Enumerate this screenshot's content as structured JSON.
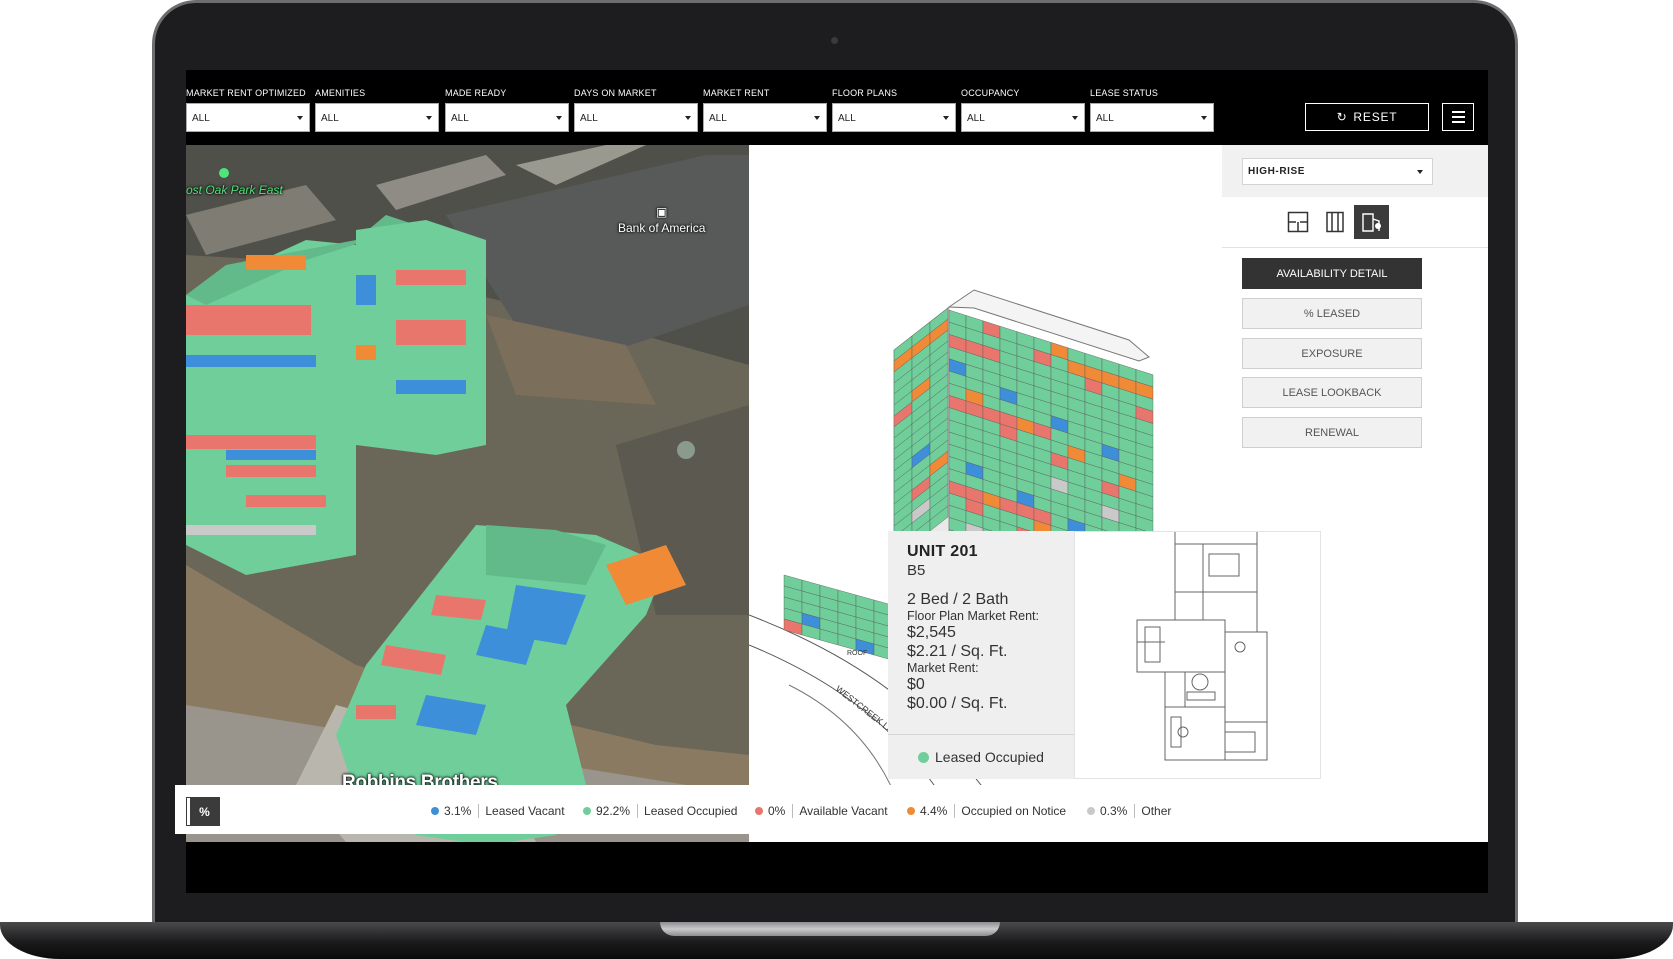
{
  "colors": {
    "leased_occupied": "#6fce9a",
    "leased_vacant": "#3d8fd9",
    "available_vacant": "#e8766c",
    "occupied_on_notice": "#f08a36",
    "other": "#c9c9c9"
  },
  "filters": [
    {
      "label": "MARKET RENT OPTIMIZED",
      "value": "ALL"
    },
    {
      "label": "AMENITIES",
      "value": "ALL"
    },
    {
      "label": "MADE READY",
      "value": "ALL"
    },
    {
      "label": "DAYS ON MARKET",
      "value": "ALL"
    },
    {
      "label": "MARKET RENT",
      "value": "ALL"
    },
    {
      "label": "FLOOR PLANS",
      "value": "ALL"
    },
    {
      "label": "OCCUPANCY",
      "value": "ALL"
    },
    {
      "label": "LEASE STATUS",
      "value": "ALL"
    }
  ],
  "toolbar": {
    "reset_label": "RESET",
    "reset_icon": "refresh-icon",
    "menu_icon": "hamburger-icon"
  },
  "map": {
    "labels": {
      "park": "ost Oak Park East",
      "bank": "Bank of America",
      "store": "Robbins Brothers"
    }
  },
  "stack": {
    "roof_label": "ROOF",
    "street_label": "WESTCREEK LANE",
    "stack_floors": 19,
    "annex_floors": 5
  },
  "sidebar": {
    "building": "HIGH-RISE",
    "view_icons": [
      "floor-plan-icon",
      "elevation-icon",
      "building-map-icon"
    ],
    "buttons": [
      "AVAILABILITY DETAIL",
      "% LEASED",
      "EXPOSURE",
      "LEASE LOOKBACK",
      "RENEWAL"
    ]
  },
  "unit": {
    "title": "UNIT 201",
    "plan": "B5",
    "beds_baths": "2 Bed / 2 Bath",
    "fp_rent_label": "Floor Plan Market Rent:",
    "fp_rent": "$2,545",
    "fp_rent_sqft": "$2.21 / Sq. Ft.",
    "market_rent_label": "Market Rent:",
    "market_rent": "$0",
    "market_rent_sqft": "$0.00 / Sq. Ft.",
    "status": "Leased Occupied"
  },
  "legend": {
    "toggle_label": "%",
    "items": [
      {
        "pct": "3.1%",
        "label": "Leased Vacant"
      },
      {
        "pct": "92.2%",
        "label": "Leased Occupied"
      },
      {
        "pct": "0%",
        "label": "Available Vacant"
      },
      {
        "pct": "4.4%",
        "label": "Occupied on Notice"
      },
      {
        "pct": "0.3%",
        "label": "Other"
      }
    ]
  }
}
